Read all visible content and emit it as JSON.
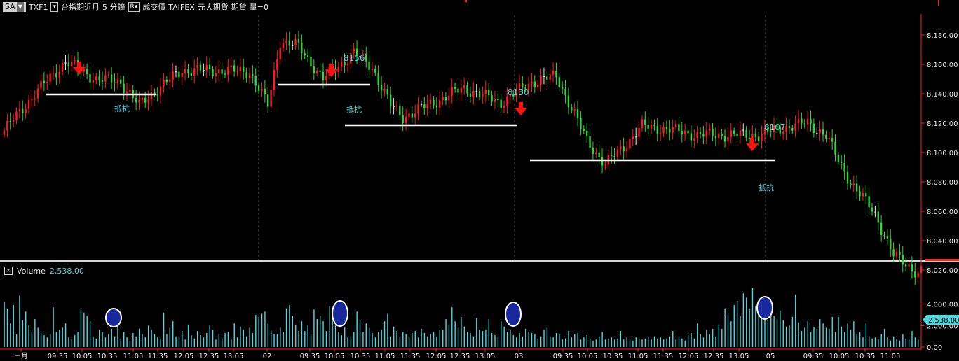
{
  "toolbar": {
    "symbol_box": "SA",
    "symbol": "TXF1",
    "product": "台指期近月",
    "interval": "5 分鐘",
    "price_type": "成交價",
    "exchange": "TAIFEX",
    "broker": "元大期貨",
    "category": "期貨",
    "volume_label": "量=0",
    "dropdown_icon": "chevron-down-icon",
    "r_box": "R"
  },
  "volume_panel": {
    "title": "Volume",
    "value": "2,538.00",
    "current_tag": "2,538.00"
  },
  "colors": {
    "up": "#ff1c1c",
    "down": "#32d832",
    "doji": "#e8e8e8",
    "volume": "#4fd8e0",
    "annotation_text": "#4fd8e0",
    "arrow": "#ff1010",
    "support_line": "#ffffff",
    "ellipse_fill": "#1a2aa8",
    "axis_line": "#ff2020"
  },
  "price_axis": {
    "labels": [
      "8,180.00",
      "8,160.00",
      "8,140.00",
      "8,120.00",
      "8,100.00",
      "8,080.00",
      "8,060.00",
      "8,040.00",
      "8,020.00"
    ],
    "min": 8012,
    "max": 8190
  },
  "volume_axis": {
    "labels": [
      "4,000.00",
      "2,000.00",
      "0.00"
    ],
    "max": 5600
  },
  "time_axis": {
    "labels": [
      "三月",
      "09:35",
      "10:05",
      "10:35",
      "11:05",
      "11:35",
      "12:05",
      "12:35",
      "13:05",
      "02",
      "09:35",
      "10:05",
      "10:35",
      "11:05",
      "11:35",
      "12:05",
      "12:35",
      "13:05",
      "03",
      "09:35",
      "10:05",
      "10:35",
      "11:05",
      "11:35",
      "12:05",
      "12:35",
      "13:05",
      "05",
      "09:35",
      "10:05",
      "10:35",
      "11:05"
    ]
  },
  "annotations": {
    "texts": [
      "抵抗",
      "8156",
      "抵抗",
      "8130",
      "8107",
      "抵抗"
    ],
    "arrows": [
      "arrow-down-icon",
      "arrow-down-icon",
      "arrow-down-icon",
      "arrow-down-icon"
    ],
    "markers": [
      "volume-circle",
      "volume-circle",
      "volume-circle",
      "volume-circle"
    ]
  },
  "chart_data": {
    "type": "candlestick",
    "ylim": [
      8012,
      8190
    ],
    "volume_ylim": [
      0,
      5600
    ],
    "series": [
      {
        "name": "Volume",
        "values": [
          4200,
          3600,
          2200,
          3900,
          1200,
          4800,
          2500,
          3300,
          2000,
          1400,
          2600,
          1800,
          1300,
          1100,
          900,
          1200,
          3700,
          1400,
          1600,
          1800,
          2200,
          900,
          700,
          1100,
          1400,
          3500,
          3200,
          2900,
          2400,
          900,
          800,
          1600,
          1400,
          900,
          1200,
          1700,
          1000,
          2100,
          800,
          1400,
          900,
          600,
          1300,
          1000,
          1700,
          1200,
          900,
          2000,
          1600,
          1200,
          900,
          800,
          3200,
          1200,
          1800,
          2400,
          1000,
          900,
          1500,
          700,
          2100,
          1100,
          800,
          1500,
          1100,
          900,
          1300,
          2000,
          1600,
          700,
          1200,
          800,
          1300,
          1400,
          700,
          2200,
          900,
          1900,
          1600,
          1000,
          1800,
          1300,
          3000,
          2800,
          3100,
          3300,
          2200,
          1500,
          1200,
          1200,
          1800,
          1400,
          3600,
          3900,
          2900,
          2100,
          1500,
          2400,
          1500,
          2000,
          1200,
          3500,
          2600,
          2900,
          2400,
          1500,
          3800,
          3300,
          2000,
          1400,
          1100,
          1800,
          900,
          1000,
          1400,
          3300,
          2500,
          1400,
          2200,
          1800,
          1300,
          900,
          1400,
          1600,
          2400,
          3100,
          1000,
          1900,
          1500,
          900,
          1400,
          1200,
          900,
          1300,
          1500,
          900,
          1700,
          1300,
          1000,
          1200,
          1400,
          1000,
          1600,
          1600,
          2600,
          2100,
          3700,
          2400,
          1800,
          2800,
          1900,
          1400,
          1300,
          1000,
          2700,
          1600,
          1500,
          1600,
          2600,
          1300,
          1100,
          900,
          2400,
          1900,
          1400,
          1600,
          1100,
          900,
          1300,
          1000,
          1700,
          1400,
          1300,
          1200,
          800,
          1000,
          1600,
          1800,
          1000,
          900,
          1300,
          1200,
          700,
          800,
          1500,
          900,
          1200,
          1300,
          700,
          900,
          1100,
          800,
          600,
          700,
          1000,
          1400,
          700,
          800,
          900,
          700,
          800,
          1500,
          700,
          900,
          700,
          600,
          900,
          800,
          700,
          800,
          900,
          700,
          1000,
          800,
          900,
          700,
          800,
          1000,
          1500,
          700,
          1000,
          800,
          600,
          1100,
          1300,
          800,
          2200,
          1200,
          900,
          1600,
          1200,
          1700,
          1000,
          2100,
          1700,
          3600,
          3000,
          2400,
          3900,
          4300,
          2900,
          5000,
          4600,
          3600,
          5500,
          3800,
          3300,
          4200,
          3100,
          2500,
          3900,
          2900,
          2600,
          3400,
          2500,
          1900,
          2000,
          2800,
          4900,
          2300,
          1500,
          1800,
          2400,
          1400,
          1900,
          1700,
          2600,
          2200,
          1800,
          1700,
          2800,
          1400,
          2800,
          1900,
          1400,
          2200,
          1600,
          2400,
          1200,
          1400,
          900,
          2200,
          1000,
          800,
          900,
          700,
          1200,
          1700,
          900,
          600,
          1000,
          700,
          600,
          1200,
          800,
          700,
          1500,
          900,
          700
        ]
      },
      {
        "name": "OHLC",
        "values": []
      }
    ]
  }
}
